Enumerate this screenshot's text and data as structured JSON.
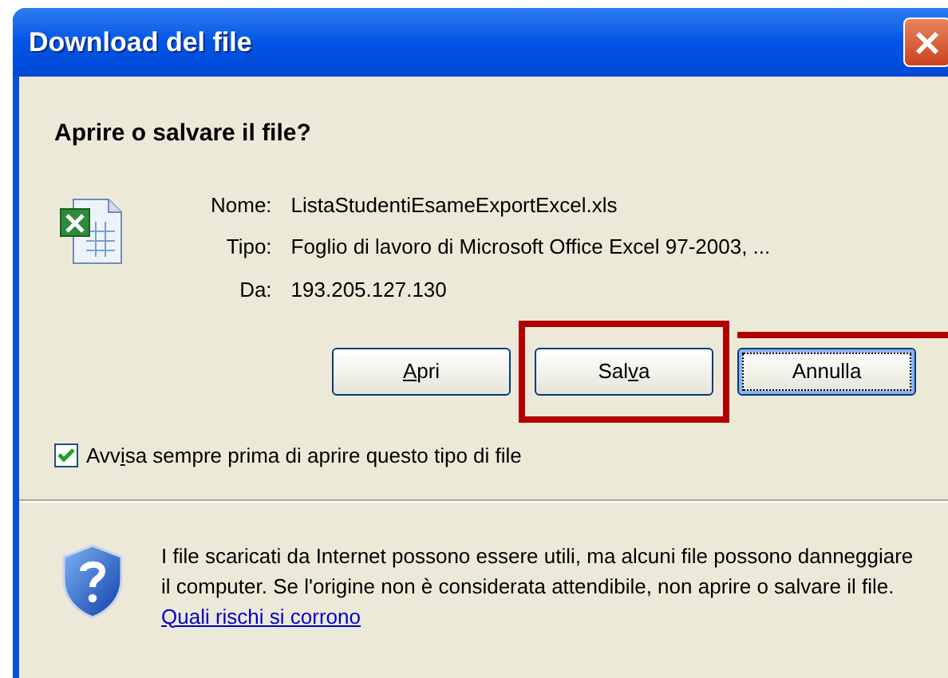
{
  "window": {
    "title": "Download del file"
  },
  "heading": "Aprire o salvare il file?",
  "file_info": [
    {
      "label": "Nome:",
      "value": "ListaStudentiEsameExportExcel.xls"
    },
    {
      "label": "Tipo:",
      "value": "Foglio di lavoro di Microsoft Office Excel 97-2003, ..."
    },
    {
      "label": "Da:",
      "value": "193.205.127.130"
    }
  ],
  "buttons": [
    {
      "key": "A",
      "after": "pri",
      "focused": false,
      "highlighted": false
    },
    {
      "before": "Sal",
      "key": "v",
      "after": "a",
      "focused": false,
      "highlighted": true
    },
    {
      "before": "Annulla",
      "focused": true,
      "highlighted": false
    }
  ],
  "always_ask": {
    "before": "Avv",
    "key": "i",
    "after": "sa sempre prima di aprire questo tipo di file",
    "checked": true
  },
  "warning": {
    "text": "I file scaricati da Internet possono essere utili, ma alcuni file possono danneggiare il computer. Se l'origine non è considerata attendibile, non aprire o salvare il file.",
    "link": "Quali rischi si corrono"
  }
}
